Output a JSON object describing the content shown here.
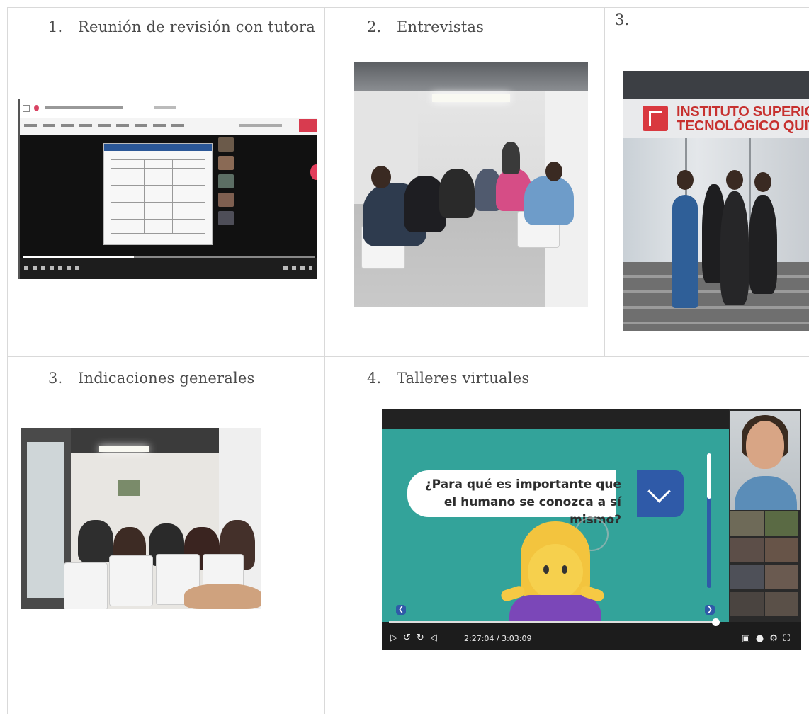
{
  "cells": [
    {
      "number": "1.",
      "caption": "Reunión de revisión con tutora"
    },
    {
      "number": "2.",
      "caption": "Entrevistas"
    },
    {
      "number": "3.",
      "caption": ""
    },
    {
      "number": "3.",
      "caption": "Indicaciones generales"
    },
    {
      "number": "4.",
      "caption": "Talleres virtuales"
    }
  ],
  "photo_building": {
    "sign_line1": "INSTITUTO SUPERIOR",
    "sign_line2": "TECNOLÓGICO QUITO"
  },
  "photo_workshop": {
    "question": "¿Para qué es importante que el humano se conozca a sí mismo?",
    "time": "2:27:04 / 3:03:09",
    "progress_fraction": 0.98
  },
  "colors": {
    "grid_line": "#d9d9d9",
    "slide_teal": "#33a39a",
    "accent_blue": "#2f5aa8",
    "sign_red": "#d9383f"
  }
}
